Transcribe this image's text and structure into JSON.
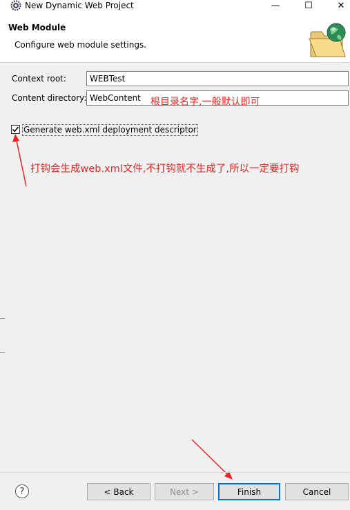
{
  "window": {
    "title": "New Dynamic Web Project",
    "minimize": "—",
    "maximize": "☐",
    "close": "✕"
  },
  "header": {
    "title": "Web Module",
    "description": "Configure web module settings.",
    "icon": "folder-globe-icon"
  },
  "form": {
    "context_root": {
      "label": "Context root:",
      "value": "WEBTest"
    },
    "content_directory": {
      "label": "Content directory:",
      "value": "WebContent"
    },
    "generate_xml": {
      "label": "Generate web.xml deployment descriptor",
      "checked": true
    }
  },
  "annotations": {
    "content_note": "根目录名字,一般默认即可",
    "checkbox_note": "打钩会生成web.xml文件,不打钩就不生成了,所以一定要打钩",
    "color": "#ee2222"
  },
  "footer": {
    "help": "?",
    "back": "< Back",
    "next": "Next >",
    "finish": "Finish",
    "cancel": "Cancel"
  }
}
